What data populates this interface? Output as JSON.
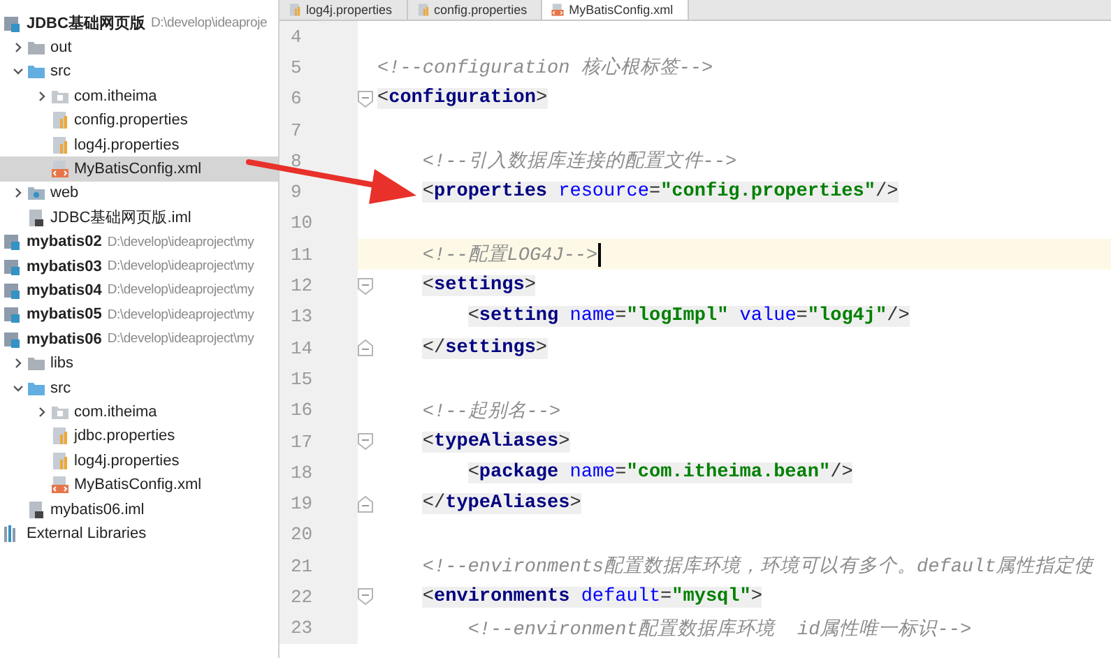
{
  "project_tree": {
    "items": [
      {
        "label": "JDBC基础网页版",
        "kind": "module",
        "path": "D:\\develop\\ideaproje",
        "expanded": true,
        "selected": false,
        "children": [
          {
            "label": "out",
            "kind": "folder",
            "expanded": false,
            "selected": false
          },
          {
            "label": "src",
            "kind": "source-folder",
            "expanded": true,
            "selected": false,
            "children": [
              {
                "label": "com.itheima",
                "kind": "package",
                "expanded": false,
                "selected": false
              },
              {
                "label": "config.properties",
                "kind": "properties",
                "selected": false
              },
              {
                "label": "log4j.properties",
                "kind": "properties",
                "selected": false
              },
              {
                "label": "MyBatisConfig.xml",
                "kind": "xml",
                "selected": true
              }
            ]
          },
          {
            "label": "web",
            "kind": "web-folder",
            "expanded": false,
            "selected": false
          },
          {
            "label": "JDBC基础网页版.iml",
            "kind": "iml",
            "selected": false
          }
        ]
      },
      {
        "label": "mybatis02",
        "kind": "module",
        "path": "D:\\develop\\ideaproject\\my",
        "selected": false
      },
      {
        "label": "mybatis03",
        "kind": "module",
        "path": "D:\\develop\\ideaproject\\my",
        "selected": false
      },
      {
        "label": "mybatis04",
        "kind": "module",
        "path": "D:\\develop\\ideaproject\\my",
        "selected": false
      },
      {
        "label": "mybatis05",
        "kind": "module",
        "path": "D:\\develop\\ideaproject\\my",
        "selected": false
      },
      {
        "label": "mybatis06",
        "kind": "module",
        "path": "D:\\develop\\ideaproject\\my",
        "expanded": true,
        "selected": false,
        "children": [
          {
            "label": "libs",
            "kind": "folder",
            "expanded": false,
            "selected": false
          },
          {
            "label": "src",
            "kind": "source-folder",
            "expanded": true,
            "selected": false,
            "children": [
              {
                "label": "com.itheima",
                "kind": "package",
                "expanded": false,
                "selected": false
              },
              {
                "label": "jdbc.properties",
                "kind": "properties",
                "selected": false
              },
              {
                "label": "log4j.properties",
                "kind": "properties",
                "selected": false
              },
              {
                "label": "MyBatisConfig.xml",
                "kind": "xml",
                "selected": false
              }
            ]
          },
          {
            "label": "mybatis06.iml",
            "kind": "iml",
            "selected": false
          }
        ]
      },
      {
        "label": "External Libraries",
        "kind": "libraries",
        "selected": false
      }
    ]
  },
  "editor_tabs": [
    {
      "label": "log4j.properties",
      "kind": "properties",
      "selected": false
    },
    {
      "label": "config.properties",
      "kind": "properties",
      "selected": false
    },
    {
      "label": "MyBatisConfig.xml",
      "kind": "xml",
      "selected": true
    }
  ],
  "editor": {
    "lines": [
      {
        "number": "4",
        "kind": "plain",
        "current": false
      },
      {
        "number": "5",
        "kind": "plain",
        "current": false,
        "tokens": [
          {
            "kind": "comment",
            "text": "<!--configuration 核心根标签-->"
          }
        ]
      },
      {
        "number": "6",
        "kind": "fold-start",
        "current": false,
        "tokens": [
          {
            "kind": "bracket",
            "text": "<"
          },
          {
            "kind": "tag",
            "text": "configuration"
          },
          {
            "kind": "bracket",
            "text": ">"
          }
        ]
      },
      {
        "number": "7",
        "kind": "plain",
        "current": false
      },
      {
        "number": "8",
        "kind": "plain",
        "current": false,
        "tokens": [
          {
            "kind": "comment",
            "text": "    <!--引入数据库连接的配置文件-->"
          }
        ]
      },
      {
        "number": "9",
        "kind": "plain",
        "current": false,
        "tokens": [
          {
            "kind": "bracket",
            "text": "    <"
          },
          {
            "kind": "tag",
            "text": "properties"
          },
          {
            "kind": "attr",
            "text": " resource"
          },
          {
            "kind": "bracket",
            "text": "="
          },
          {
            "kind": "value",
            "text": "\"config.properties\""
          },
          {
            "kind": "bracket",
            "text": "/>"
          }
        ]
      },
      {
        "number": "10",
        "kind": "plain",
        "current": false
      },
      {
        "number": "11",
        "kind": "plain",
        "current": true,
        "tokens": [
          {
            "kind": "comment",
            "text": "    <!--配置LOG4J-->"
          }
        ]
      },
      {
        "number": "12",
        "kind": "fold-start",
        "current": false,
        "tokens": [
          {
            "kind": "bracket",
            "text": "    <"
          },
          {
            "kind": "tag",
            "text": "settings"
          },
          {
            "kind": "bracket",
            "text": ">"
          }
        ]
      },
      {
        "number": "13",
        "kind": "plain",
        "current": false,
        "tokens": [
          {
            "kind": "bracket",
            "text": "        <"
          },
          {
            "kind": "tag",
            "text": "setting"
          },
          {
            "kind": "attr",
            "text": " name"
          },
          {
            "kind": "bracket",
            "text": "="
          },
          {
            "kind": "value",
            "text": "\"logImpl\""
          },
          {
            "kind": "attr",
            "text": " value"
          },
          {
            "kind": "bracket",
            "text": "="
          },
          {
            "kind": "value",
            "text": "\"log4j\""
          },
          {
            "kind": "bracket",
            "text": "/>"
          }
        ]
      },
      {
        "number": "14",
        "kind": "fold-end",
        "current": false,
        "tokens": [
          {
            "kind": "bracket",
            "text": "    </"
          },
          {
            "kind": "tag",
            "text": "settings"
          },
          {
            "kind": "bracket",
            "text": ">"
          }
        ]
      },
      {
        "number": "15",
        "kind": "plain",
        "current": false
      },
      {
        "number": "16",
        "kind": "plain",
        "current": false,
        "tokens": [
          {
            "kind": "comment",
            "text": "    <!--起别名-->"
          }
        ]
      },
      {
        "number": "17",
        "kind": "fold-start",
        "current": false,
        "tokens": [
          {
            "kind": "bracket",
            "text": "    <"
          },
          {
            "kind": "tag",
            "text": "typeAliases"
          },
          {
            "kind": "bracket",
            "text": ">"
          }
        ]
      },
      {
        "number": "18",
        "kind": "plain",
        "current": false,
        "tokens": [
          {
            "kind": "bracket",
            "text": "        <"
          },
          {
            "kind": "tag",
            "text": "package"
          },
          {
            "kind": "attr",
            "text": " name"
          },
          {
            "kind": "bracket",
            "text": "="
          },
          {
            "kind": "value",
            "text": "\"com.itheima.bean\""
          },
          {
            "kind": "bracket",
            "text": "/>"
          }
        ]
      },
      {
        "number": "19",
        "kind": "fold-end",
        "current": false,
        "tokens": [
          {
            "kind": "bracket",
            "text": "    </"
          },
          {
            "kind": "tag",
            "text": "typeAliases"
          },
          {
            "kind": "bracket",
            "text": ">"
          }
        ]
      },
      {
        "number": "20",
        "kind": "plain",
        "current": false
      },
      {
        "number": "21",
        "kind": "plain",
        "current": false,
        "tokens": [
          {
            "kind": "comment",
            "text": "    <!--environments配置数据库环境，环境可以有多个。default属性指定使"
          }
        ]
      },
      {
        "number": "22",
        "kind": "fold-start",
        "current": false,
        "tokens": [
          {
            "kind": "bracket",
            "text": "    <"
          },
          {
            "kind": "tag",
            "text": "environments"
          },
          {
            "kind": "attr",
            "text": " default"
          },
          {
            "kind": "bracket",
            "text": "="
          },
          {
            "kind": "value",
            "text": "\"mysql\""
          },
          {
            "kind": "bracket",
            "text": ">"
          }
        ]
      },
      {
        "number": "23",
        "kind": "plain",
        "current": false,
        "tokens": [
          {
            "kind": "comment",
            "text": "        <!--environment配置数据库环境  id属性唯一标识-->"
          }
        ]
      }
    ]
  }
}
